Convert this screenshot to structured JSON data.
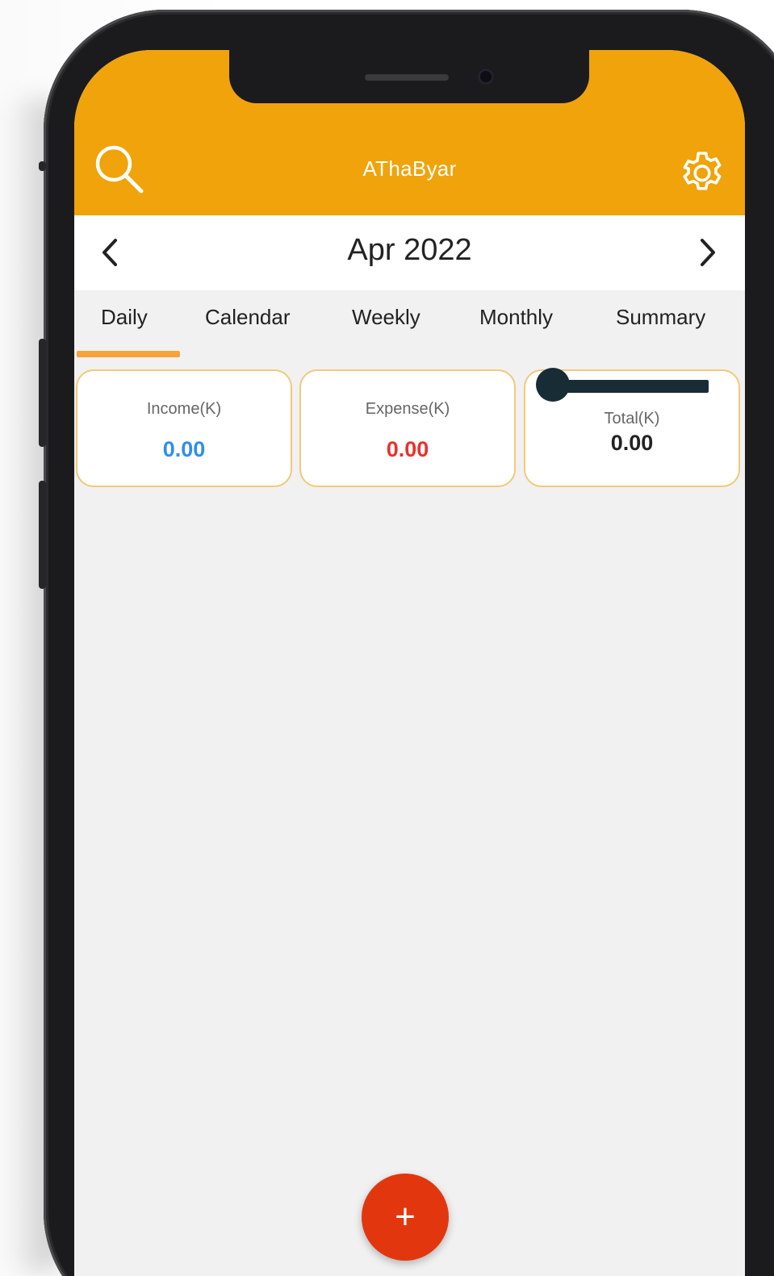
{
  "app": {
    "title": "AThaByar"
  },
  "header": {
    "search_icon": "search-icon",
    "settings_icon": "gear-icon"
  },
  "month_nav": {
    "label": "Apr 2022",
    "prev_icon": "chevron-left-icon",
    "next_icon": "chevron-right-icon"
  },
  "tabs": [
    {
      "label": "Daily",
      "active": true
    },
    {
      "label": "Calendar",
      "active": false
    },
    {
      "label": "Weekly",
      "active": false
    },
    {
      "label": "Monthly",
      "active": false
    },
    {
      "label": "Summary",
      "active": false
    }
  ],
  "summary": {
    "income": {
      "label": "Income(K)",
      "value": "0.00",
      "color": "#2f8ef0"
    },
    "expense": {
      "label": "Expense(K)",
      "value": "0.00",
      "color": "#e8322c"
    },
    "total": {
      "label": "Total(K)",
      "value": "0.00",
      "color": "#222222"
    }
  },
  "fab": {
    "label": "+",
    "icon": "plus-icon",
    "color": "#e2370e"
  },
  "colors": {
    "appbar": "#f0a30a",
    "tab_indicator": "#f7a23b",
    "card_border": "#f2c97a"
  }
}
